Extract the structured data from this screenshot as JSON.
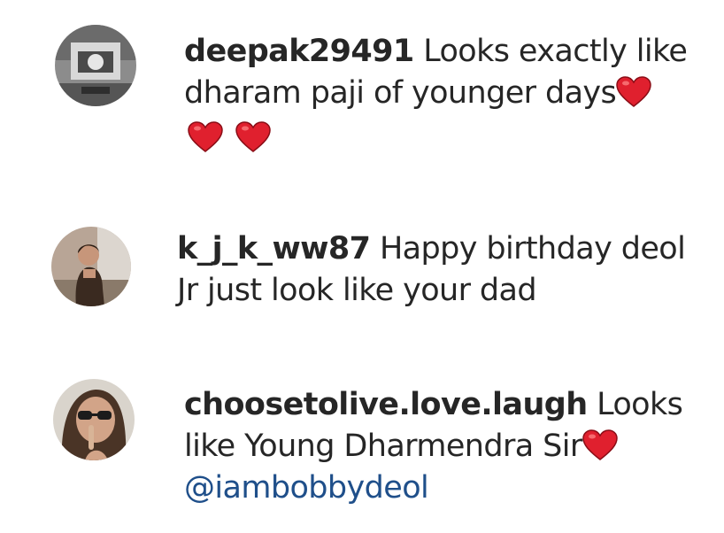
{
  "comments": [
    {
      "username": "deepak29491",
      "text_line1": "Looks exactly like",
      "text_line2": "dharam paji of younger days",
      "avatar_icon": "grayscale-photo-avatar"
    },
    {
      "username": "k_j_k_ww87",
      "text_line1": "Happy birthday deol",
      "text_line2": "Jr just look like your dad",
      "avatar_icon": "woman-photo-avatar"
    },
    {
      "username": "choosetolive.love.laugh",
      "text_line1": "Looks",
      "text_line2": "like Young Dharmendra Sir",
      "mention": "@iambobbydeol",
      "avatar_icon": "woman-sunglasses-photo-avatar"
    }
  ],
  "colors": {
    "text": "#262626",
    "mention": "#1f4f8a",
    "heart": "#e0202e"
  },
  "icons": {
    "heart": "red-heart-emoji"
  }
}
